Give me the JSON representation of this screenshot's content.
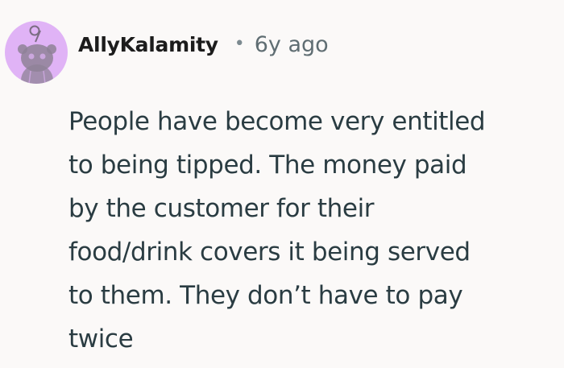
{
  "comment": {
    "username": "AllyKalamity",
    "separator": "•",
    "timestamp": "6y ago",
    "avatar_icon": "reddit-snoo-avatar-icon",
    "avatar_color": "#e0b3f6",
    "body_lines": [
      "People have become very entitled",
      "to being tipped. The money paid",
      "by the customer for their",
      "food/drink covers it being served",
      "to them. They don’t have to pay",
      "twice"
    ]
  }
}
